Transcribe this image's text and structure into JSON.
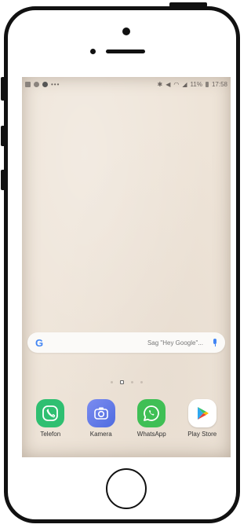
{
  "status_bar": {
    "battery": "11%",
    "time": "17:58"
  },
  "search_bar": {
    "logo": "G",
    "placeholder": "Sag \"Hey Google\"..."
  },
  "dock": {
    "apps": [
      {
        "label": "Telefon",
        "icon": "phone-icon"
      },
      {
        "label": "Kamera",
        "icon": "camera-icon"
      },
      {
        "label": "WhatsApp",
        "icon": "whatsapp-icon"
      },
      {
        "label": "Play Store",
        "icon": "play-store-icon"
      }
    ]
  },
  "colors": {
    "wallpaper": "#eee4d8",
    "frame": "#111111",
    "google_blue": "#4285f4"
  }
}
